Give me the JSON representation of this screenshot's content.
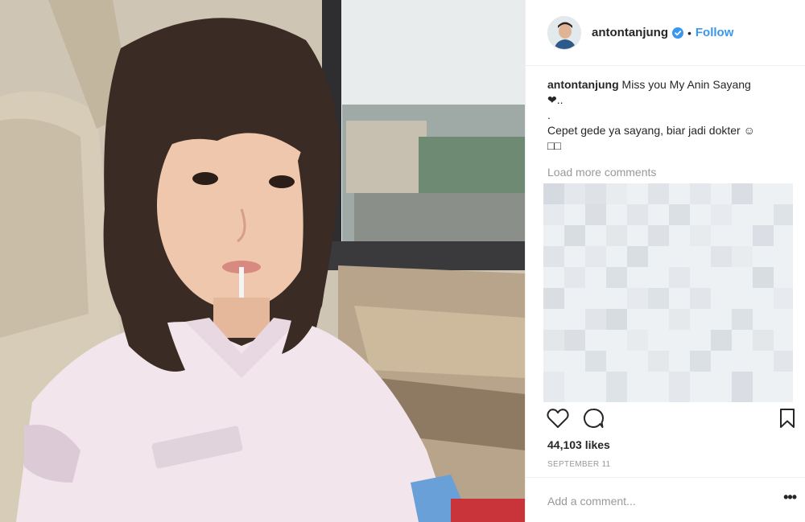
{
  "post": {
    "username": "antontanjung",
    "follow_label": "Follow",
    "separator": "•",
    "icons": {
      "verified": "verified-badge-icon",
      "like": "heart-outline-icon",
      "comment": "comment-bubble-icon",
      "save": "bookmark-icon",
      "more": "more-dots-icon"
    },
    "caption": {
      "user": "antontanjung",
      "text_line1": "Miss you My Anin Sayang",
      "text_line2": "❤..",
      "text_line3": ".",
      "text_line4": "Cepet gede ya sayang, biar jadi dokter ☺",
      "text_line5": "□□"
    },
    "load_more": "Load more comments",
    "likes": "44,103 likes",
    "date": "SEPTEMBER 11",
    "comment_placeholder": "Add a comment...",
    "more_label": "•••"
  },
  "colors": {
    "accent": "#3897f0",
    "text": "#262626",
    "muted": "#999999",
    "border": "#efefef"
  }
}
